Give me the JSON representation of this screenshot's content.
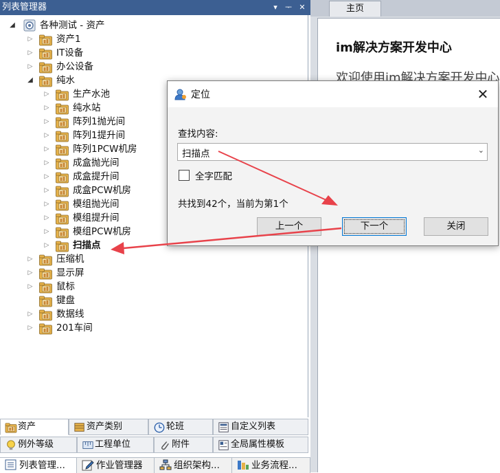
{
  "left_panel": {
    "title": "列表管理器",
    "title_buttons": {
      "dropdown": "▾",
      "pin": "ᅮ",
      "close": "✕"
    },
    "tree": {
      "root": "各种测试 - 资产",
      "items": [
        {
          "label": "资产1",
          "level": 1,
          "expander": "collapsed"
        },
        {
          "label": "IT设备",
          "level": 1,
          "expander": "collapsed"
        },
        {
          "label": "办公设备",
          "level": 1,
          "expander": "collapsed"
        },
        {
          "label": "纯水",
          "level": 1,
          "expander": "expanded"
        },
        {
          "label": "生产水池",
          "level": 2,
          "expander": "collapsed"
        },
        {
          "label": "纯水站",
          "level": 2,
          "expander": "collapsed"
        },
        {
          "label": "阵列1抛光间",
          "level": 2,
          "expander": "collapsed"
        },
        {
          "label": "阵列1提升间",
          "level": 2,
          "expander": "collapsed"
        },
        {
          "label": "阵列1PCW机房",
          "level": 2,
          "expander": "collapsed"
        },
        {
          "label": "成盒抛光间",
          "level": 2,
          "expander": "collapsed"
        },
        {
          "label": "成盒提升间",
          "level": 2,
          "expander": "collapsed"
        },
        {
          "label": "成盒PCW机房",
          "level": 2,
          "expander": "collapsed"
        },
        {
          "label": "模组抛光间",
          "level": 2,
          "expander": "collapsed"
        },
        {
          "label": "模组提升间",
          "level": 2,
          "expander": "collapsed"
        },
        {
          "label": "模组PCW机房",
          "level": 2,
          "expander": "collapsed"
        },
        {
          "label": "扫描点",
          "level": 2,
          "expander": "collapsed",
          "highlighted": true
        },
        {
          "label": "压缩机",
          "level": 1,
          "expander": "collapsed"
        },
        {
          "label": "显示屏",
          "level": 1,
          "expander": "collapsed"
        },
        {
          "label": "鼠标",
          "level": 1,
          "expander": "collapsed"
        },
        {
          "label": "键盘",
          "level": 1,
          "expander": "none"
        },
        {
          "label": "数据线",
          "level": 1,
          "expander": "collapsed"
        },
        {
          "label": "201车间",
          "level": 1,
          "expander": "collapsed"
        }
      ]
    },
    "tabs_row1": [
      "资产",
      "资产类别",
      "轮班",
      "自定义列表"
    ],
    "tabs_row2": [
      "例外等级",
      "工程单位",
      "附件",
      "全局属性模板"
    ],
    "active_tab": "资产"
  },
  "bottom_tabs": [
    "列表管理...",
    "作业管理器",
    "组织架构...",
    "业务流程..."
  ],
  "right_area": {
    "tab_home": "主页",
    "title": "im解决方案开发中心",
    "welcome": "欢迎使用im解决方案开发中心"
  },
  "dialog": {
    "title": "定位",
    "close_glyph": "✕",
    "find_label": "查找内容:",
    "find_value": "扫描点",
    "dropdown_glyph": "⌄",
    "match_label": "全字匹配",
    "match_checked": false,
    "status": "共找到42个，当前为第1个",
    "buttons": {
      "prev": "上一个",
      "next": "下一个",
      "close": "关闭"
    }
  },
  "colors": {
    "titlebar": "#3c5f92",
    "annotation_arrow": "#e8424a",
    "folder_icon": "#e8b64a",
    "dialog_focus": "#0078d7"
  }
}
